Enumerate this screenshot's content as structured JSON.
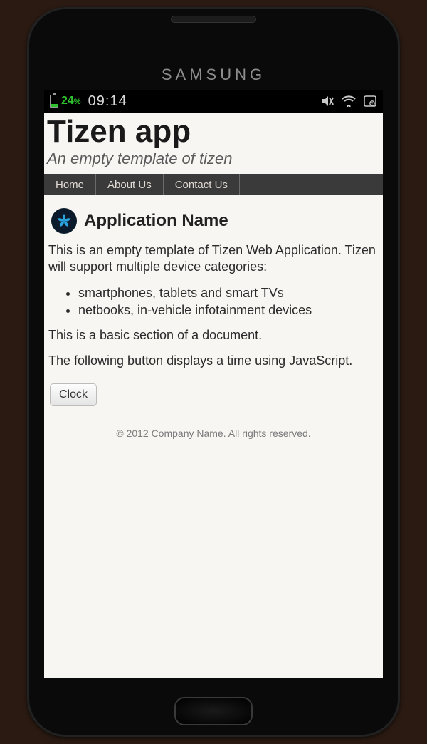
{
  "device_brand": "SAMSUNG",
  "statusbar": {
    "battery_percent": "24",
    "percent_sign": "%",
    "time": "09:14"
  },
  "header": {
    "title": "Tizen app",
    "subtitle": "An empty template of tizen"
  },
  "nav": {
    "items": [
      "Home",
      "About Us",
      "Contact Us"
    ]
  },
  "app": {
    "name": "Application Name",
    "intro": "This is an empty template of Tizen Web Application. Tizen will support multiple device categories:",
    "bullets": [
      "smartphones, tablets and smart TVs",
      "netbooks, in-vehicle infotainment devices"
    ],
    "section_text": "This is a basic section of a document.",
    "button_text": "The following button displays a time using JavaScript.",
    "clock_button": "Clock"
  },
  "footer": "© 2012 Company Name. All rights reserved."
}
